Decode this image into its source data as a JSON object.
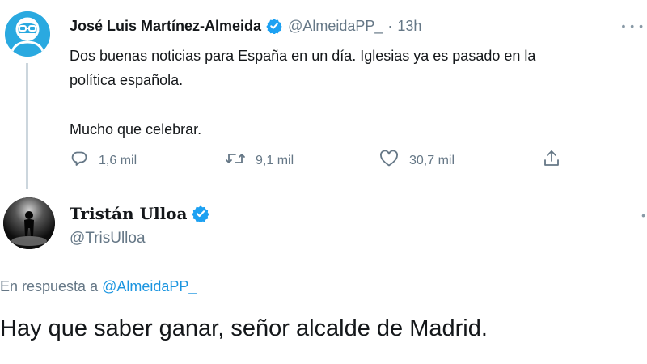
{
  "tweet1": {
    "author_name": "José Luis Martínez-Almeida",
    "handle": "@AlmeidaPP_",
    "separator": "·",
    "time": "13h",
    "text_line1": "Dos buenas noticias para España en un día. Iglesias ya es pasado en la",
    "text_line2": "política española.",
    "text_line3": "Mucho que celebrar.",
    "replies": "1,6 mil",
    "retweets": "9,1 mil",
    "likes": "30,7 mil",
    "icons": [
      "reply-icon",
      "retweet-icon",
      "like-icon",
      "share-icon",
      "verified-icon",
      "more-icon"
    ]
  },
  "tweet2": {
    "author_name": "Tristán Ulloa",
    "handle": "@TrisUlloa",
    "reply_prefix": "En respuesta a",
    "reply_to": "@AlmeidaPP_",
    "text": "Hay que saber ganar, señor alcalde de Madrid."
  },
  "colors": {
    "accent": "#1da1f2",
    "link": "#1b95e0",
    "secondary_text": "#657786",
    "avatar1_bg": "#2aa9e0"
  }
}
